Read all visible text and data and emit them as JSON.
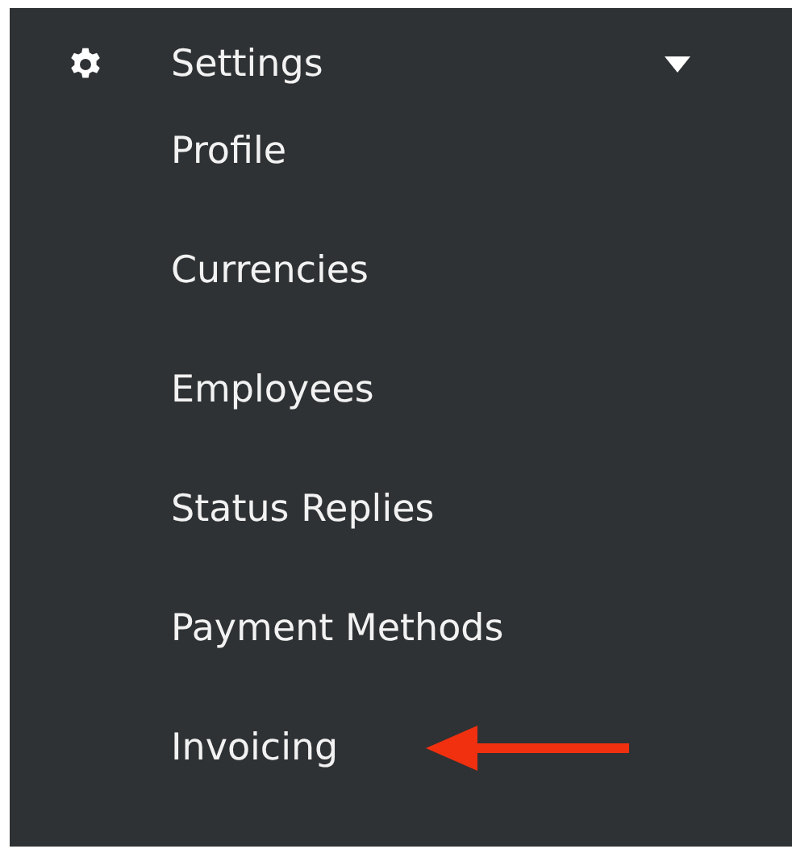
{
  "menu": {
    "label": "Settings",
    "expanded": true,
    "items": [
      {
        "label": "Profile",
        "marked": false
      },
      {
        "label": "Currencies",
        "marked": false
      },
      {
        "label": "Employees",
        "marked": false
      },
      {
        "label": "Status Replies",
        "marked": false
      },
      {
        "label": "Payment Methods",
        "marked": false
      },
      {
        "label": "Invoicing",
        "marked": true
      }
    ]
  }
}
